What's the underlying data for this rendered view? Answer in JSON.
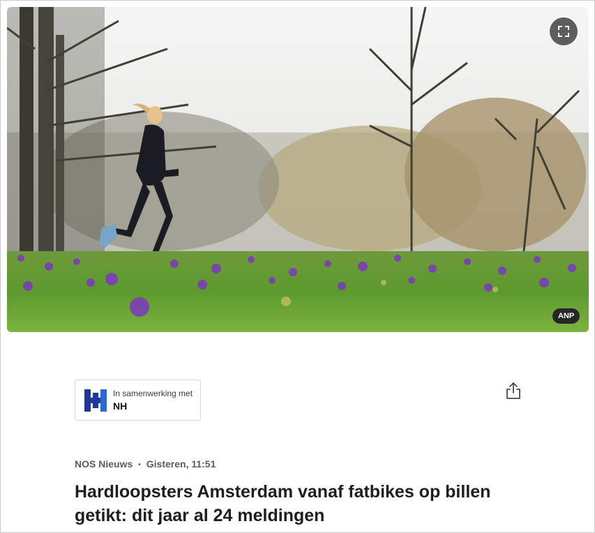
{
  "hero": {
    "alt": "Hardloopster in park met krokussen",
    "credit": "ANP",
    "fullscreen_icon": "fullscreen-icon"
  },
  "partner": {
    "intro": "In samenwerking met",
    "name": "NH",
    "logo_icon": "nh-logo-icon",
    "logo_color": "#1d3a9a"
  },
  "share": {
    "icon": "share-icon",
    "label": "Delen"
  },
  "meta": {
    "source": "NOS Nieuws",
    "separator": "•",
    "timestamp": "Gisteren, 11:51"
  },
  "headline": "Hardloopsters Amsterdam vanaf fatbikes op billen getikt: dit jaar al 24 meldingen",
  "colors": {
    "text": "#1e1e1e",
    "meta": "#5b5b5b",
    "accent_purple": "#7a3fb5",
    "grass": "#5c9a2e"
  }
}
